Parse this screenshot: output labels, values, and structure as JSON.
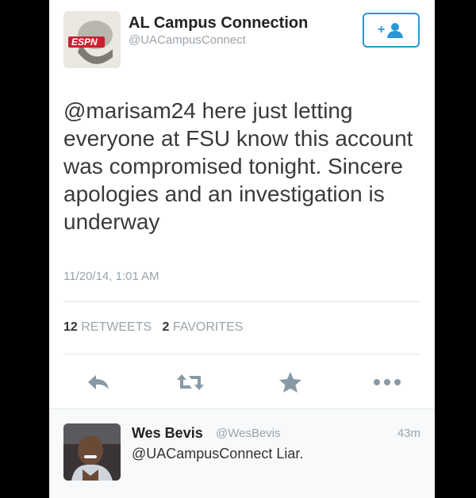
{
  "tweet": {
    "display_name": "AL Campus Connection",
    "handle": "@UACampusConnect",
    "text": "@marisam24 here just letting everyone at FSU know this account was compromised tonight. Sincere apologies and an investigation is underway",
    "timestamp": "11/20/14, 1:01 AM",
    "retweets_count": "12",
    "retweets_label": "RETWEETS",
    "favorites_count": "2",
    "favorites_label": "FAVORITES",
    "avatar_logo_text": "ESPN",
    "follow_icon": "add-user-icon"
  },
  "actions": {
    "icons": [
      "reply-icon",
      "retweet-icon",
      "favorite-star-icon",
      "more-dots-icon"
    ]
  },
  "reply": {
    "display_name": "Wes Bevis",
    "handle": "@WesBevis",
    "time": "43m",
    "text": "@UACampusConnect Liar."
  },
  "colors": {
    "accent": "#2b95d6",
    "icon_gray": "#8899a6",
    "muted_text": "#9aa4ad",
    "background": "#000000"
  }
}
